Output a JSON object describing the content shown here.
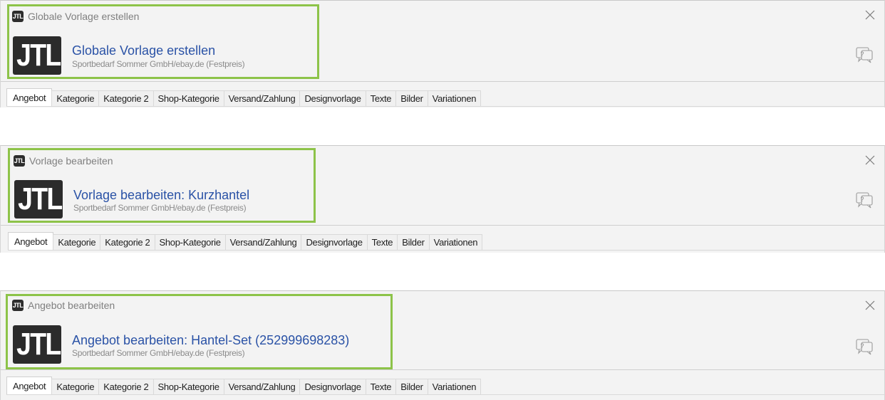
{
  "panels": [
    {
      "window_title": "Globale Vorlage erstellen",
      "heading": "Globale Vorlage erstellen",
      "subtitle": "Sportbedarf Sommer GmbH/ebay.de (Festpreis)",
      "logo_small": "JTL",
      "logo_big": "JTL",
      "tabs": [
        "Angebot",
        "Kategorie",
        "Kategorie 2",
        "Shop-Kategorie",
        "Versand/Zahlung",
        "Designvorlage",
        "Texte",
        "Bilder",
        "Variationen"
      ],
      "active_tab": "Angebot"
    },
    {
      "window_title": "Vorlage bearbeiten",
      "heading": "Vorlage bearbeiten: Kurzhantel",
      "subtitle": "Sportbedarf Sommer GmbH/ebay.de (Festpreis)",
      "logo_small": "JTL",
      "logo_big": "JTL",
      "tabs": [
        "Angebot",
        "Kategorie",
        "Kategorie 2",
        "Shop-Kategorie",
        "Versand/Zahlung",
        "Designvorlage",
        "Texte",
        "Bilder",
        "Variationen"
      ],
      "active_tab": "Angebot"
    },
    {
      "window_title": "Angebot bearbeiten",
      "heading": "Angebot bearbeiten: Hantel-Set (252999698283)",
      "subtitle": "Sportbedarf Sommer GmbH/ebay.de (Festpreis)",
      "logo_small": "JTL",
      "logo_big": "JTL",
      "tabs": [
        "Angebot",
        "Kategorie",
        "Kategorie 2",
        "Shop-Kategorie",
        "Versand/Zahlung",
        "Designvorlage",
        "Texte",
        "Bilder",
        "Variationen"
      ],
      "active_tab": "Angebot"
    }
  ],
  "icons": {
    "close": "close-icon",
    "help": "help-chat-icon"
  },
  "colors": {
    "highlight": "#8dc349",
    "heading": "#2a52a6",
    "logo_bg": "#2b2b2b"
  }
}
